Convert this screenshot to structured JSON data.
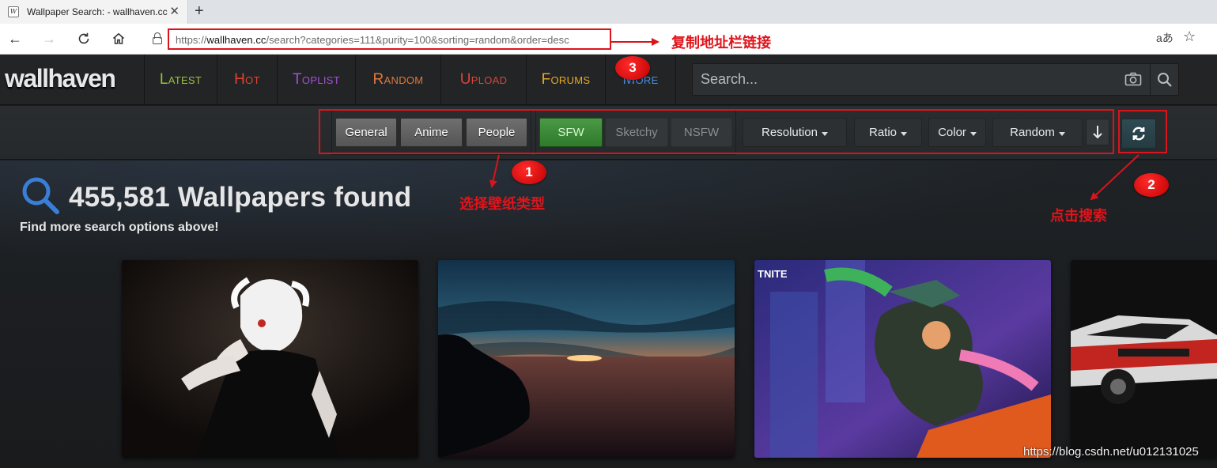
{
  "browser": {
    "tab_title": "Wallpaper Search: - wallhaven.cc",
    "favicon_text": "W",
    "url_prefix": "https://",
    "url_host": "wallhaven.cc",
    "url_path": "/search?categories=111&purity=100&sorting=random&order=desc",
    "icons": [
      "back-icon",
      "forward-icon",
      "reload-icon",
      "home-icon",
      "lock-icon",
      "read-aloud-icon",
      "favorites-icon"
    ]
  },
  "site": {
    "logo": "wallhaven",
    "nav": [
      {
        "label": "Latest",
        "color": "#9bc13c"
      },
      {
        "label": "Hot",
        "color": "#e0442f"
      },
      {
        "label": "Toplist",
        "color": "#a550d6"
      },
      {
        "label": "Random",
        "color": "#e0783c"
      },
      {
        "label": "Upload",
        "color": "#d7463b"
      },
      {
        "label": "Forums",
        "color": "#e8a828"
      },
      {
        "label": "More",
        "color": "#4a8adf"
      }
    ],
    "search_placeholder": "Search..."
  },
  "filters": {
    "categories": [
      "General",
      "Anime",
      "People"
    ],
    "purity": [
      "SFW",
      "Sketchy",
      "NSFW"
    ],
    "dropdowns": [
      "Resolution",
      "Ratio",
      "Color",
      "Random"
    ]
  },
  "results": {
    "title": "455,581 Wallpapers found",
    "subtitle": "Find more search options above!"
  },
  "annotations": {
    "copy_url": "复制地址栏链接",
    "choose_type": "选择壁纸类型",
    "click_search": "点击搜索",
    "badge_1": "1",
    "badge_2": "2",
    "badge_3": "3"
  },
  "watermark": "https://blog.csdn.net/u012131025",
  "colors": {
    "annotation_red": "#d9141b",
    "sfw_green": "#3a8a36",
    "header_bg": "#222426"
  }
}
